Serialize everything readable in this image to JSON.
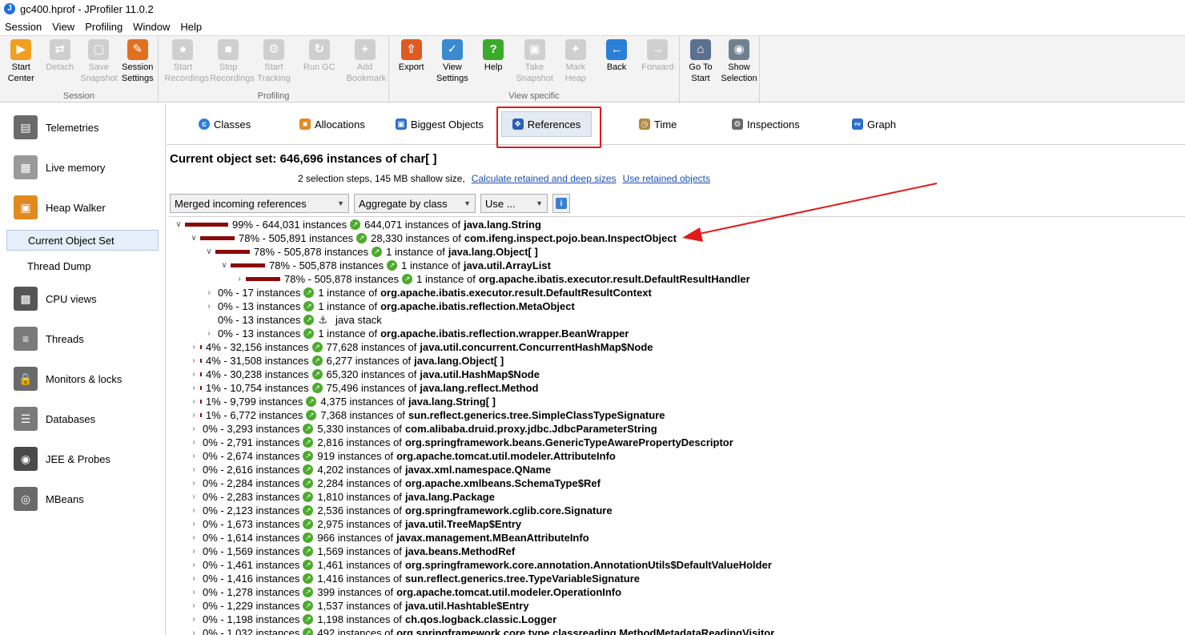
{
  "window": {
    "title": "gc400.hprof - JProfiler 11.0.2"
  },
  "menu": [
    "Session",
    "View",
    "Profiling",
    "Window",
    "Help"
  ],
  "toolbar": {
    "groups": [
      {
        "label": "Session",
        "buttons": [
          {
            "label": "Start\nCenter",
            "enabled": true,
            "icon": "start-center-icon",
            "color": "#f0a020"
          },
          {
            "label": "Detach",
            "enabled": false,
            "icon": "detach-icon"
          },
          {
            "label": "Save\nSnapshot",
            "enabled": false,
            "icon": "save-icon"
          },
          {
            "label": "Session\nSettings",
            "enabled": true,
            "icon": "settings-icon",
            "color": "#e07020"
          }
        ]
      },
      {
        "label": "Profiling",
        "buttons": [
          {
            "label": "Start\nRecordings",
            "enabled": false,
            "icon": "record-icon"
          },
          {
            "label": "Stop\nRecordings",
            "enabled": false,
            "icon": "stop-icon"
          },
          {
            "label": "Start\nTracking",
            "enabled": false,
            "icon": "tracking-icon"
          },
          {
            "label": "Run GC",
            "enabled": false,
            "icon": "gc-icon"
          },
          {
            "label": "Add\nBookmark",
            "enabled": false,
            "icon": "bookmark-icon"
          }
        ]
      },
      {
        "label": "View specific",
        "buttons": [
          {
            "label": "Export",
            "enabled": true,
            "icon": "export-icon",
            "color": "#e05a20"
          },
          {
            "label": "View\nSettings",
            "enabled": true,
            "icon": "view-settings-icon",
            "color": "#3a8ad0"
          },
          {
            "label": "Help",
            "enabled": true,
            "icon": "help-icon",
            "color": "#3aaa2a"
          },
          {
            "label": "Take\nSnapshot",
            "enabled": false,
            "icon": "camera-icon"
          },
          {
            "label": "Mark\nHeap",
            "enabled": false,
            "icon": "pin-icon"
          },
          {
            "label": "Back",
            "enabled": true,
            "icon": "back-icon",
            "color": "#2a7fd8"
          },
          {
            "label": "Forward",
            "enabled": false,
            "icon": "forward-icon"
          }
        ]
      },
      {
        "label": "",
        "buttons": [
          {
            "label": "Go To\nStart",
            "enabled": true,
            "icon": "home-icon",
            "color": "#5a7090"
          },
          {
            "label": "Show\nSelection",
            "enabled": true,
            "icon": "show-selection-icon",
            "color": "#708090"
          }
        ]
      }
    ]
  },
  "sidebar": {
    "items": [
      {
        "label": "Telemetries",
        "icon": "telemetries-icon",
        "color": "#6a6a6a"
      },
      {
        "label": "Live memory",
        "icon": "live-memory-icon",
        "color": "#9a9a9a"
      },
      {
        "label": "Heap Walker",
        "icon": "heap-walker-icon",
        "color": "#e08a20"
      },
      {
        "label": "CPU views",
        "icon": "cpu-icon",
        "color": "#555555"
      },
      {
        "label": "Threads",
        "icon": "threads-icon",
        "color": "#7a7a7a"
      },
      {
        "label": "Monitors & locks",
        "icon": "lock-icon",
        "color": "#6a6a6a"
      },
      {
        "label": "Databases",
        "icon": "database-icon",
        "color": "#7a7a7a"
      },
      {
        "label": "JEE & Probes",
        "icon": "probe-icon",
        "color": "#4a4a4a"
      },
      {
        "label": "MBeans",
        "icon": "mbeans-icon",
        "color": "#6a6a6a"
      }
    ],
    "subitems": [
      {
        "label": "Current Object Set",
        "selected": true
      },
      {
        "label": "Thread Dump",
        "selected": false
      }
    ]
  },
  "tabs": [
    {
      "label": "Classes",
      "icon": "classes-icon",
      "color": "#2a7fd8",
      "active": false
    },
    {
      "label": "Allocations",
      "icon": "allocations-icon",
      "color": "#e08a20",
      "active": false
    },
    {
      "label": "Biggest Objects",
      "icon": "biggest-objects-icon",
      "color": "#2a6fc8",
      "active": false
    },
    {
      "label": "References",
      "icon": "references-icon",
      "color": "#2a5fb8",
      "active": true
    },
    {
      "label": "Time",
      "icon": "clock-icon",
      "color": "#b08a40",
      "active": false
    },
    {
      "label": "Inspections",
      "icon": "inspections-icon",
      "color": "#6a6a6a",
      "active": false
    },
    {
      "label": "Graph",
      "icon": "graph-icon",
      "color": "#2a6fc8",
      "active": false
    }
  ],
  "object_set": {
    "title": "Current object set:  646,696 instances of char[ ]",
    "summary": "2 selection steps, 145 MB shallow size,",
    "link_retained": "Calculate retained and deep sizes",
    "link_use": "Use retained objects"
  },
  "controls": {
    "reference_mode": "Merged incoming references",
    "aggregation": "Aggregate by class",
    "use_button": "Use ..."
  },
  "accent": {
    "bar": "#8b0a0a",
    "highlight": "#e11a1a",
    "node_icon": "#4caa2d"
  },
  "tree": [
    {
      "depth": 0,
      "toggle": "open",
      "pct": 99,
      "stats": "99% - 644,031 instances",
      "count": "644,071 instances of",
      "cls": "java.lang.String",
      "icon": "ref"
    },
    {
      "depth": 1,
      "toggle": "open",
      "pct": 78,
      "stats": "78% - 505,891 instances",
      "count": "28,330 instances of",
      "cls": "com.ifeng.inspect.pojo.bean.InspectObject",
      "icon": "ref"
    },
    {
      "depth": 2,
      "toggle": "open",
      "pct": 78,
      "stats": "78% - 505,878 instances",
      "count": "1 instance of",
      "cls": "java.lang.Object[ ]",
      "icon": "ref"
    },
    {
      "depth": 3,
      "toggle": "open",
      "pct": 78,
      "stats": "78% - 505,878 instances",
      "count": "1 instance of",
      "cls": "java.util.ArrayList",
      "icon": "ref"
    },
    {
      "depth": 4,
      "toggle": "closed",
      "pct": 78,
      "stats": "78% - 505,878 instances",
      "count": "1 instance of",
      "cls": "org.apache.ibatis.executor.result.DefaultResultHandler",
      "icon": "ref"
    },
    {
      "depth": 2,
      "toggle": "closed",
      "pct": 0,
      "stats": "0% - 17 instances",
      "count": "1 instance of",
      "cls": "org.apache.ibatis.executor.result.DefaultResultContext",
      "icon": "ref"
    },
    {
      "depth": 2,
      "toggle": "closed",
      "pct": 0,
      "stats": "0% - 13 instances",
      "count": "1 instance of",
      "cls": "org.apache.ibatis.reflection.MetaObject",
      "icon": "ref"
    },
    {
      "depth": 2,
      "toggle": "none",
      "pct": 0,
      "stats": "0% - 13 instances",
      "count": "",
      "cls": "java stack",
      "icon": "anchor"
    },
    {
      "depth": 2,
      "toggle": "closed",
      "pct": 0,
      "stats": "0% - 13 instances",
      "count": "1 instance of",
      "cls": "org.apache.ibatis.reflection.wrapper.BeanWrapper",
      "icon": "ref"
    },
    {
      "depth": 1,
      "toggle": "closed",
      "pct": 4,
      "stats": "4% - 32,156 instances",
      "count": "77,628 instances of",
      "cls": "java.util.concurrent.ConcurrentHashMap$Node",
      "icon": "ref"
    },
    {
      "depth": 1,
      "toggle": "closed",
      "pct": 4,
      "stats": "4% - 31,508 instances",
      "count": "6,277 instances of",
      "cls": "java.lang.Object[ ]",
      "icon": "ref"
    },
    {
      "depth": 1,
      "toggle": "closed",
      "pct": 4,
      "stats": "4% - 30,238 instances",
      "count": "65,320 instances of",
      "cls": "java.util.HashMap$Node",
      "icon": "ref"
    },
    {
      "depth": 1,
      "toggle": "closed",
      "pct": 1,
      "stats": "1% - 10,754 instances",
      "count": "75,496 instances of",
      "cls": "java.lang.reflect.Method",
      "icon": "ref"
    },
    {
      "depth": 1,
      "toggle": "closed",
      "pct": 1,
      "stats": "1% - 9,799 instances",
      "count": "4,375 instances of",
      "cls": "java.lang.String[ ]",
      "icon": "ref"
    },
    {
      "depth": 1,
      "toggle": "closed",
      "pct": 1,
      "stats": "1% - 6,772 instances",
      "count": "7,368 instances of",
      "cls": "sun.reflect.generics.tree.SimpleClassTypeSignature",
      "icon": "ref"
    },
    {
      "depth": 1,
      "toggle": "closed",
      "pct": 0,
      "stats": "0% - 3,293 instances",
      "count": "5,330 instances of",
      "cls": "com.alibaba.druid.proxy.jdbc.JdbcParameterString",
      "icon": "ref"
    },
    {
      "depth": 1,
      "toggle": "closed",
      "pct": 0,
      "stats": "0% - 2,791 instances",
      "count": "2,816 instances of",
      "cls": "org.springframework.beans.GenericTypeAwarePropertyDescriptor",
      "icon": "ref"
    },
    {
      "depth": 1,
      "toggle": "closed",
      "pct": 0,
      "stats": "0% - 2,674 instances",
      "count": "919 instances of",
      "cls": "org.apache.tomcat.util.modeler.AttributeInfo",
      "icon": "ref"
    },
    {
      "depth": 1,
      "toggle": "closed",
      "pct": 0,
      "stats": "0% - 2,616 instances",
      "count": "4,202 instances of",
      "cls": "javax.xml.namespace.QName",
      "icon": "ref"
    },
    {
      "depth": 1,
      "toggle": "closed",
      "pct": 0,
      "stats": "0% - 2,284 instances",
      "count": "2,284 instances of",
      "cls": "org.apache.xmlbeans.SchemaType$Ref",
      "icon": "ref"
    },
    {
      "depth": 1,
      "toggle": "closed",
      "pct": 0,
      "stats": "0% - 2,283 instances",
      "count": "1,810 instances of",
      "cls": "java.lang.Package",
      "icon": "ref"
    },
    {
      "depth": 1,
      "toggle": "closed",
      "pct": 0,
      "stats": "0% - 2,123 instances",
      "count": "2,536 instances of",
      "cls": "org.springframework.cglib.core.Signature",
      "icon": "ref"
    },
    {
      "depth": 1,
      "toggle": "closed",
      "pct": 0,
      "stats": "0% - 1,673 instances",
      "count": "2,975 instances of",
      "cls": "java.util.TreeMap$Entry",
      "icon": "ref"
    },
    {
      "depth": 1,
      "toggle": "closed",
      "pct": 0,
      "stats": "0% - 1,614 instances",
      "count": "966 instances of",
      "cls": "javax.management.MBeanAttributeInfo",
      "icon": "ref"
    },
    {
      "depth": 1,
      "toggle": "closed",
      "pct": 0,
      "stats": "0% - 1,569 instances",
      "count": "1,569 instances of",
      "cls": "java.beans.MethodRef",
      "icon": "ref"
    },
    {
      "depth": 1,
      "toggle": "closed",
      "pct": 0,
      "stats": "0% - 1,461 instances",
      "count": "1,461 instances of",
      "cls": "org.springframework.core.annotation.AnnotationUtils$DefaultValueHolder",
      "icon": "ref"
    },
    {
      "depth": 1,
      "toggle": "closed",
      "pct": 0,
      "stats": "0% - 1,416 instances",
      "count": "1,416 instances of",
      "cls": "sun.reflect.generics.tree.TypeVariableSignature",
      "icon": "ref"
    },
    {
      "depth": 1,
      "toggle": "closed",
      "pct": 0,
      "stats": "0% - 1,278 instances",
      "count": "399 instances of",
      "cls": "org.apache.tomcat.util.modeler.OperationInfo",
      "icon": "ref"
    },
    {
      "depth": 1,
      "toggle": "closed",
      "pct": 0,
      "stats": "0% - 1,229 instances",
      "count": "1,537 instances of",
      "cls": "java.util.Hashtable$Entry",
      "icon": "ref"
    },
    {
      "depth": 1,
      "toggle": "closed",
      "pct": 0,
      "stats": "0% - 1,198 instances",
      "count": "1,198 instances of",
      "cls": "ch.qos.logback.classic.Logger",
      "icon": "ref"
    },
    {
      "depth": 1,
      "toggle": "closed",
      "pct": 0,
      "stats": "0% - 1,032 instances",
      "count": "492 instances of",
      "cls": "org.springframework.core.type.classreading.MethodMetadataReadingVisitor",
      "icon": "ref"
    }
  ]
}
